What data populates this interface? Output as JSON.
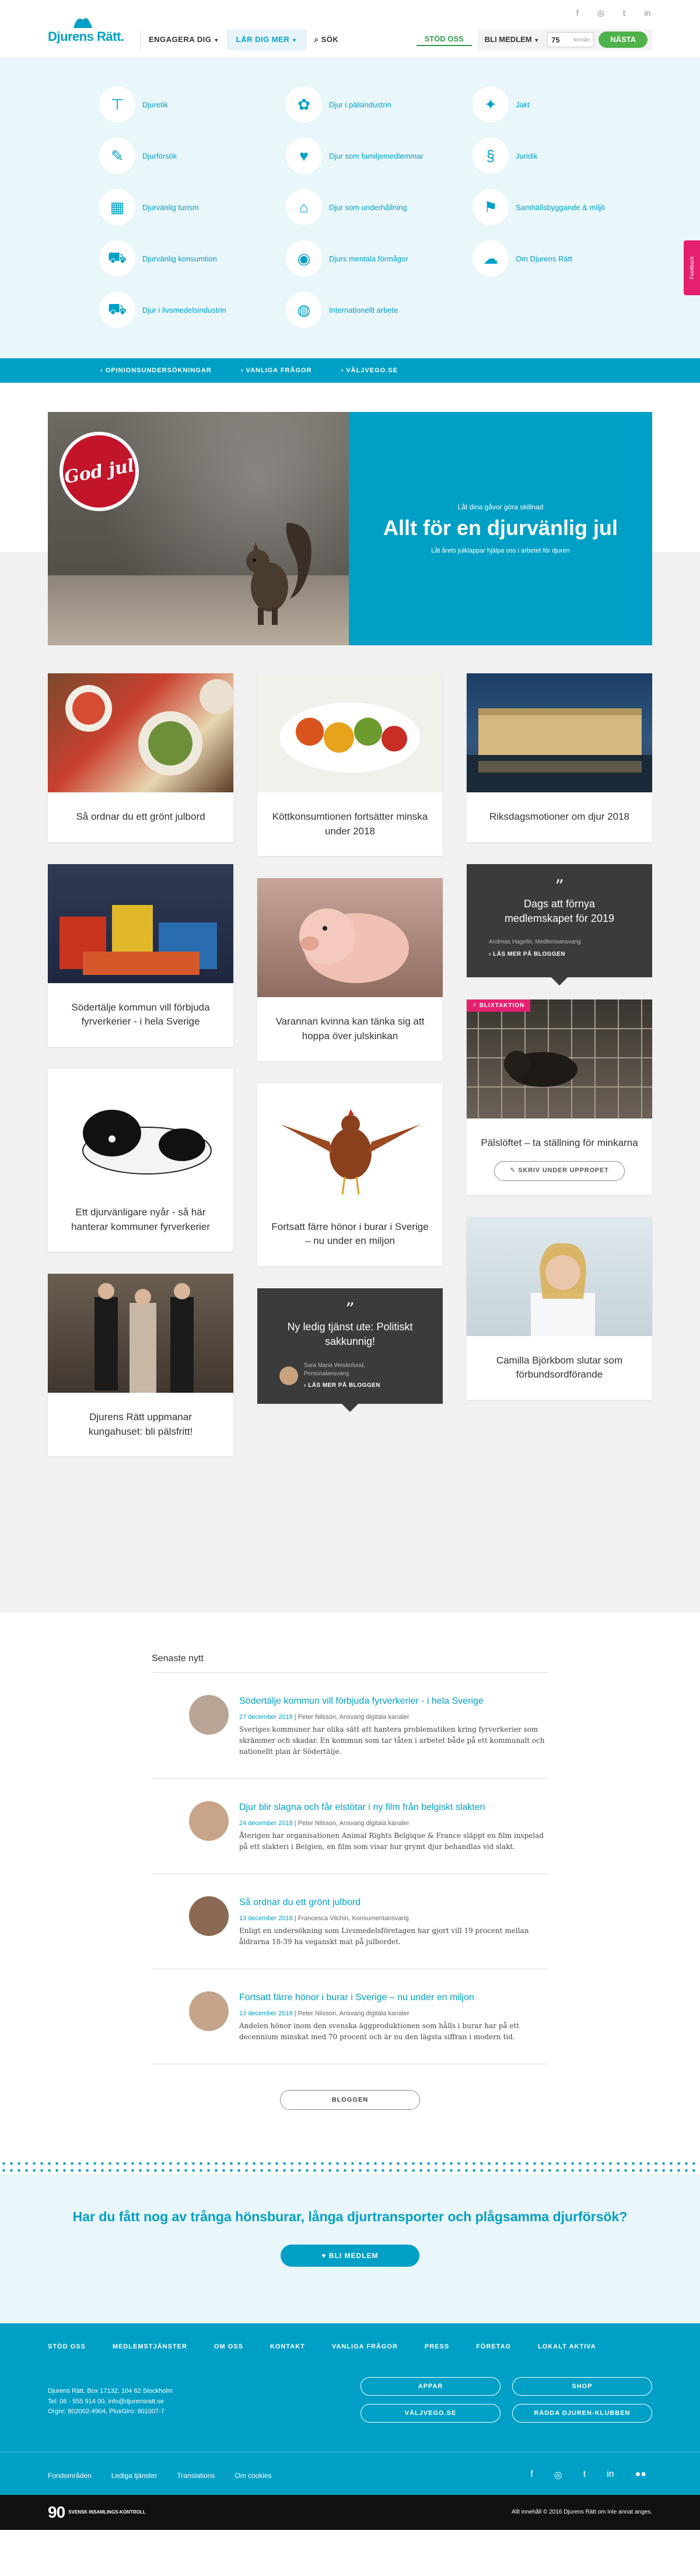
{
  "header": {
    "logo_text": "Djurens Rätt.",
    "nav": [
      {
        "label": "Engagera dig",
        "active": false
      },
      {
        "label": "Lär dig mer",
        "active": true
      },
      {
        "label": "Sök",
        "active": false
      }
    ],
    "stod_label": "Stöd oss",
    "bli_label": "Bli medlem",
    "amount_value": "75",
    "amount_unit": "kr/mån",
    "next_label": "Nästa",
    "social": [
      "f",
      "◎",
      "t",
      "in"
    ]
  },
  "megamenu": {
    "items": [
      {
        "icon": "⊤",
        "label": "Djuretik"
      },
      {
        "icon": "✿",
        "label": "Djur i pälsindustrin"
      },
      {
        "icon": "✦",
        "label": "Jakt"
      },
      {
        "icon": "✎",
        "label": "Djurförsök"
      },
      {
        "icon": "♥",
        "label": "Djur som familjemedlemmar"
      },
      {
        "icon": "§",
        "label": "Juridik"
      },
      {
        "icon": "▦",
        "label": "Djurvänlig turism"
      },
      {
        "icon": "⌂",
        "label": "Djur som underhållning"
      },
      {
        "icon": "⚑",
        "label": "Samhällsbyggande & miljö"
      },
      {
        "icon": "⛟",
        "label": "Djurvänlig konsumtion"
      },
      {
        "icon": "◉",
        "label": "Djurs mentala förmågor"
      },
      {
        "icon": "☁",
        "label": "Om Djurens Rätt"
      },
      {
        "icon": "⛟",
        "label": "Djur i livsmedelsindustrin"
      },
      {
        "icon": "◍",
        "label": "Internationellt arbete"
      }
    ]
  },
  "strip": [
    "› Opinionsundersökningar",
    "› Vanliga frågor",
    "› Väljvego.se"
  ],
  "hero": {
    "seal": "God jul",
    "pre": "Låt dina gåvor göra skillnad",
    "title": "Allt för en djurvänlig jul",
    "sub": "Låt årets julklappar hjälpa oss i arbetet för djuren"
  },
  "cards": {
    "c1": "Så ordnar du ett grönt julbord",
    "c2": "Köttkonsumtionen fortsätter minska under 2018",
    "c3": "Riksdagsmotioner om djur 2018",
    "c4": "Södertälje kommun vill förbjuda fyrverkerier - i hela Sverige",
    "c5": "Varannan kvinna kan tänka sig att hoppa över julskinkan",
    "c6": "Pälslöftet – ta ställning för minkarna",
    "c6_tag": "Blixtaktion",
    "c6_btn": "✎ Skriv under uppropet",
    "c7": "Ett djurvänligare nyår - så här hanterar kommuner fyrverkerier",
    "c8": "Fortsatt färre hönor i burar i Sverige – nu under en miljon",
    "c9": "Djurens Rätt uppmanar kungahuset: bli pälsfritt!",
    "c10": "Camilla Björkbom slutar som förbundsordförande"
  },
  "dark1": {
    "quote": "Dags att förnya medlemskapet för 2019",
    "author": "Andreas Hagelin, Medlemsansvarig",
    "more": "› Läs mer på bloggen"
  },
  "dark2": {
    "quote": "Ny ledig tjänst ute: Politiskt sakkunnig!",
    "author_name": "Sara Maria Westerlund,",
    "author_role": "Personalansvarig",
    "more": "› Läs mer på bloggen"
  },
  "news": {
    "heading": "Senaste nytt",
    "items": [
      {
        "title": "Södertälje kommun vill förbjuda fyrverkerier - i hela Sverige",
        "date": "27 december 2018",
        "author": "Peter Nilsson, Ansvarig digitala kanaler",
        "desc": "Sveriges kommuner har olika sätt att hantera problematiken kring fyrverkerier som skrämmer och skadar. En kommun som tar tåten i arbetet både på ett kommunalt och nationellt plan är Södertälje."
      },
      {
        "title": "Djur blir slagna och får elstötar i ny film från belgiskt slakteri",
        "date": "24 december 2018",
        "author": "Peter Nilsson, Ansvarig digitala kanaler",
        "desc": "Återigen har organisationen Animal Rights Belgique & France släppt en film inspelad på ett slakteri i Belgien, en film som visar hur grymt djur behandlas vid slakt."
      },
      {
        "title": "Så ordnar du ett grönt julbord",
        "date": "13 december 2018",
        "author": "Francesca Vilchin, Konsumentansvarig",
        "desc": "Enligt en undersökning som Livsmedelsföretagen har gjort vill 19 procent mellan åldrarna 18-39 ha veganskt mat på julbordet."
      },
      {
        "title": "Fortsatt färre hönor i burar i Sverige – nu under en miljon",
        "date": "13 december 2018",
        "author": "Peter Nilsson, Ansvarig digitala kanaler",
        "desc": "Andelen hönor inom den svenska äggproduktionen som hålls i burar har på ett decennium minskat med 70 procent och är nu den lägsta siffran i modern tid."
      }
    ],
    "blog_btn": "Bloggen"
  },
  "cta": {
    "title": "Har du fått nog av trånga hönsburar, långa djurtransporter och plågsamma djurförsök?",
    "btn": "♥ Bli medlem"
  },
  "footer": {
    "nav": [
      "Stöd oss",
      "Medlemstjänster",
      "Om oss",
      "Kontakt",
      "Vanliga frågor",
      "Press",
      "Företag",
      "Lokalt aktiva"
    ],
    "addr1": "Djurens Rätt, Box 17132, 104 62 Stockholm",
    "addr2": "Tel: 08 - 555 914 00, info@djurensratt.se",
    "addr3": "Orgnr: 802002-4904, PlusGiro: 901007-7",
    "btns": [
      "Appar",
      "Shop",
      "Väljvego.se",
      "Rädda djuren-klubben"
    ],
    "links": [
      "Fondområden",
      "Lediga tjänster",
      "Translations",
      "Om cookies"
    ],
    "social": [
      "f",
      "◎",
      "t",
      "in",
      "●●"
    ],
    "svk_num": "90",
    "svk_text": "SVENSK INSAMLINGS-KONTROLL",
    "copy": "Allt innehåll © 2016 Djurens Rätt om inte annat anges."
  },
  "feedback": "Feedback"
}
